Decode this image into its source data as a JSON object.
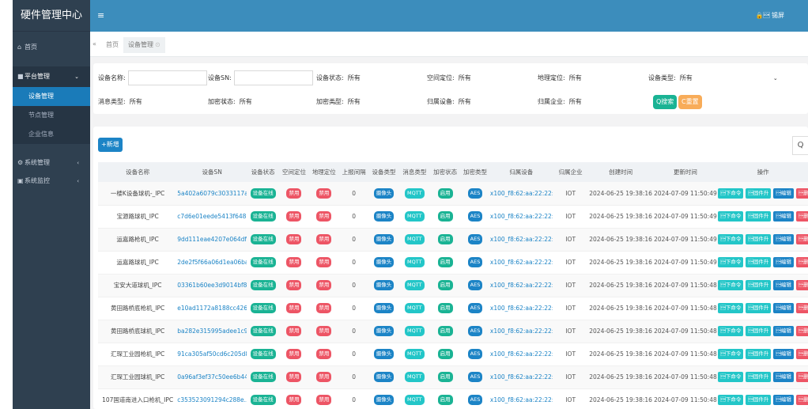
{
  "app": {
    "title": "硬件管理中心",
    "user": "\u0001 锡屏",
    "menu_icon": "≡"
  },
  "sidebar": {
    "home": "首页",
    "platform": "平台管理",
    "sub": [
      "设备管理",
      "节点管理",
      "企业信息"
    ],
    "system": "系统管理",
    "monitor": "系统监控"
  },
  "tabs": {
    "back": "«",
    "home": "首页",
    "current": "设备管理",
    "close": "⊙"
  },
  "filters": {
    "name_label": "设备名称:",
    "name_value": "",
    "sn_label": "设备SN:",
    "sn_value": "",
    "status_label": "设备状态:",
    "status_value": "所有",
    "space_label": "空间定位:",
    "space_value": "所有",
    "geo_label": "地理定位:",
    "geo_value": "所有",
    "type_label": "设备类型:",
    "type_value": "所有",
    "msgtype_label": "消息类型:",
    "msgtype_value": "所有",
    "encstatus_label": "加密状态:",
    "encstatus_value": "所有",
    "enctype_label": "加密类型:",
    "enctype_value": "所有",
    "owner_label": "归属设备:",
    "owner_value": "所有",
    "company_label": "归属企业:",
    "company_value": "所有",
    "search_btn": "Q搜索",
    "reset_btn": "C重置"
  },
  "actions": {
    "add": "+新增",
    "search_icon": "Q"
  },
  "table": {
    "headers": [
      "设备名称",
      "设备SN",
      "设备状态",
      "空间定位",
      "地理定位",
      "上报间隔",
      "设备类型",
      "消息类型",
      "加密状态",
      "加密类型",
      "归属设备",
      "归属企业",
      "创建时间",
      "更新时间",
      "操作"
    ],
    "badges": {
      "status": "设备在线",
      "space": "禁用",
      "geo": "禁用",
      "type": "摄像头",
      "msg": "MQTT",
      "enc": "启用",
      "enctype": "AES"
    },
    "ops": [
      "\u0001下命令",
      "\u0001固件升",
      "\u0001编辑",
      "\u0001删除"
    ],
    "rows": [
      {
        "name": "一楼K设备球机-_IPC",
        "sn": "5a402a6079c3033117a8...",
        "interval": "0",
        "dev": "x100_f8:62:aa:22:22:...",
        "company": "IOT",
        "created": "2024-06-25 19:38:16",
        "updated": "2024-07-09 11:50:49"
      },
      {
        "name": "宝源路球机_IPC",
        "sn": "c7d6e01eede5413f6480...",
        "interval": "0",
        "dev": "x100_f8:62:aa:22:22:...",
        "company": "IOT",
        "created": "2024-06-25 19:38:16",
        "updated": "2024-07-09 11:50:49"
      },
      {
        "name": "运嘉路枪机_IPC",
        "sn": "9dd111eae4207e064dff...",
        "interval": "0",
        "dev": "x100_f8:62:aa:22:22:...",
        "company": "IOT",
        "created": "2024-06-25 19:38:16",
        "updated": "2024-07-09 11:50:49"
      },
      {
        "name": "运嘉路球机_IPC",
        "sn": "2de2f5f66a06d1ea06ba...",
        "interval": "0",
        "dev": "x100_f8:62:aa:22:22:...",
        "company": "IOT",
        "created": "2024-06-25 19:38:16",
        "updated": "2024-07-09 11:50:49"
      },
      {
        "name": "宝安大道球机_IPC",
        "sn": "03361b60ee3d9014bf89...",
        "interval": "0",
        "dev": "x100_f8:62:aa:22:22:...",
        "company": "IOT",
        "created": "2024-06-25 19:38:16",
        "updated": "2024-07-09 11:50:48"
      },
      {
        "name": "黄田路桥底枪机_IPC",
        "sn": "e10ad1172a8188cc426d...",
        "interval": "0",
        "dev": "x100_f8:62:aa:22:22:...",
        "company": "IOT",
        "created": "2024-06-25 19:38:16",
        "updated": "2024-07-09 11:50:48"
      },
      {
        "name": "黄田路桥底球机_IPC",
        "sn": "ba282e315995adee1c92...",
        "interval": "0",
        "dev": "x100_f8:62:aa:22:22:...",
        "company": "IOT",
        "created": "2024-06-25 19:38:16",
        "updated": "2024-07-09 11:50:48"
      },
      {
        "name": "汇琛工业园枪机_IPC",
        "sn": "91ca305af50cd6c205d8...",
        "interval": "0",
        "dev": "x100_f8:62:aa:22:22:...",
        "company": "IOT",
        "created": "2024-06-25 19:38:16",
        "updated": "2024-07-09 11:50:48"
      },
      {
        "name": "汇琛工业园球机_IPC",
        "sn": "0a96af3ef37c50ee6b44...",
        "interval": "0",
        "dev": "x100_f8:62:aa:22:22:...",
        "company": "IOT",
        "created": "2024-06-25 19:38:16",
        "updated": "2024-07-09 11:50:48"
      },
      {
        "name": "107国道南进入口枪机_IPC",
        "sn": "c353523091294c288e...",
        "interval": "0",
        "dev": "x100_f8:62:aa:22:22:...",
        "company": "IOT",
        "created": "2024-06-25 19:38:16",
        "updated": "2024-07-09 11:50:48"
      }
    ]
  }
}
